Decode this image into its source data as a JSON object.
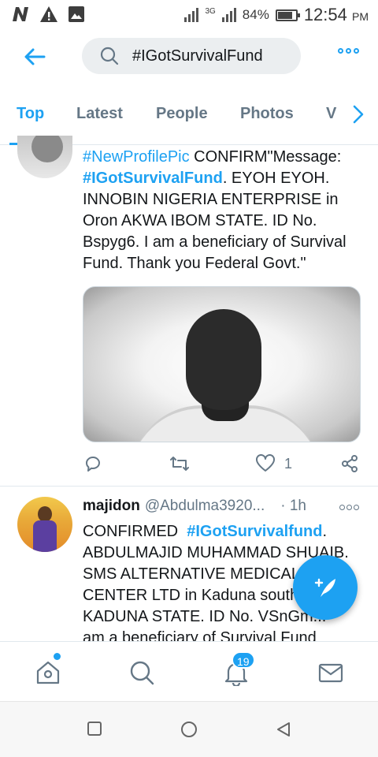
{
  "status_bar": {
    "signal_type": "3G",
    "battery": "84%",
    "battery_level": 0.84,
    "time": "12:54",
    "ampm": "PM"
  },
  "header": {
    "search_value": "#IGotSurvivalFund"
  },
  "tabs": [
    {
      "label": "Top",
      "active": true
    },
    {
      "label": "Latest"
    },
    {
      "label": "People"
    },
    {
      "label": "Photos"
    },
    {
      "label": "V"
    }
  ],
  "tweet1": {
    "hashtag1": "#NewProfilePic",
    "text1": " CONFIRM\"Message:",
    "hashtag2": "#IGotSurvivalFund",
    "text2": ". EYOH EYOH.",
    "line3": "INNOBIN NIGERIA ENTERPRISE in",
    "line4": "Oron AKWA IBOM STATE. ID No.",
    "line5": "Bspyg6. I am a beneficiary of Survival",
    "line6": "Fund. Thank you Federal Govt.\"",
    "like_count": "1"
  },
  "tweet2": {
    "name": "majidon",
    "handle": "@Abdulma3920...",
    "time": "· 1h",
    "text1": "CONFIRMED",
    "hashtag": "#IGotSurvivalfund",
    "text1_end": ".",
    "line2": "ABDULMAJID MUHAMMAD SHUAIB.",
    "line3": "SMS ALTERNATIVE MEDICAL",
    "line4": "CENTER LTD in Kaduna south",
    "line5": "KADUNA STATE. ID No. VSnGm...",
    "line6": "am a beneficiary of Survival Fund"
  },
  "bottom_nav": {
    "notifications_badge": "19"
  },
  "colors": {
    "accent": "#1da1f2",
    "text": "#14171a",
    "secondary": "#657786"
  }
}
